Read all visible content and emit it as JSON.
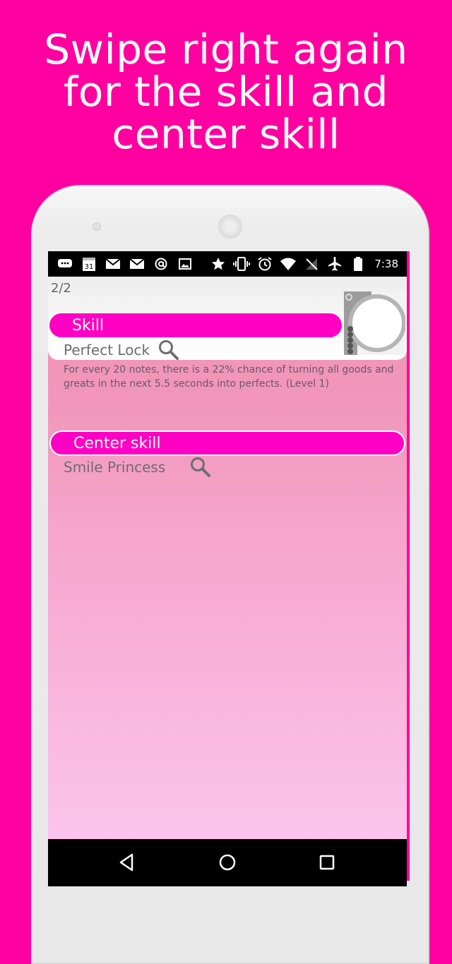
{
  "headline": {
    "line1": "Swipe right again",
    "line2": "for the skill and",
    "line3": "center skill"
  },
  "status_bar": {
    "time": "7:38",
    "calendar_day": "31",
    "left_icons": [
      "message-icon",
      "calendar-icon",
      "gmail-icon",
      "gmail-icon",
      "at-icon",
      "image-icon"
    ],
    "right_icons": [
      "star-icon",
      "vibrate-icon",
      "alarm-icon",
      "wifi-icon",
      "no-signal-icon",
      "airplane-icon",
      "battery-icon"
    ]
  },
  "content": {
    "page_indicator": "2/2",
    "skill": {
      "label": "Skill",
      "name": "Perfect Lock",
      "description": "For every 20 notes, there is a 22% chance of turning all goods and greats in the next 5.5 seconds into perfects. (Level 1)"
    },
    "center_skill": {
      "label": "Center skill",
      "name": "Smile Princess"
    }
  },
  "nav_bar": {
    "icons": [
      "back-icon",
      "home-icon",
      "recents-icon"
    ]
  },
  "colors": {
    "background": "#ff00a0",
    "accent_pill": "#ff00c4",
    "text_gray": "#6d6d6d"
  }
}
